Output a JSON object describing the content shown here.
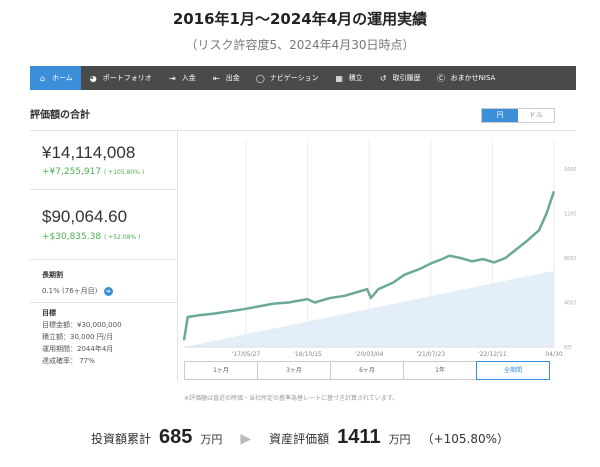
{
  "header": {
    "title": "2016年1月〜2024年4月の運用実績",
    "subtitle": "（リスク許容度5、2024年4月30日時点）"
  },
  "nav": {
    "items": [
      {
        "label": "ホーム",
        "icon": "home-icon",
        "active": true
      },
      {
        "label": "ポートフォリオ",
        "icon": "pie-chart-icon"
      },
      {
        "label": "入金",
        "icon": "deposit-icon"
      },
      {
        "label": "出金",
        "icon": "withdraw-icon"
      },
      {
        "label": "ナビゲーション",
        "icon": "compass-icon"
      },
      {
        "label": "積立",
        "icon": "savings-icon"
      },
      {
        "label": "取引履歴",
        "icon": "history-icon"
      },
      {
        "label": "おまかせNISA",
        "icon": "nisa-icon"
      }
    ]
  },
  "section": {
    "title": "評価額の合計",
    "currency_options": [
      "円",
      "ドル"
    ],
    "currency_selected": "円"
  },
  "summary_panel": {
    "jpy_value": "¥14,114,008",
    "jpy_change": "+¥7,255,917",
    "jpy_change_pct": "( +105.80% )",
    "usd_value": "$90,064.60",
    "usd_change": "+$30,835.38",
    "usd_change_pct": "( +52.08% )",
    "long_term_label": "長期割",
    "long_term_value": "0.1% (76ヶ月目)",
    "goal_label": "目標",
    "goal_amount": "目標金額：¥30,000,000",
    "goal_monthly": "積立額：30,000 円/月",
    "goal_period": "運用期間：2044年4月",
    "goal_rate": "達成確率： 77%"
  },
  "ranges": {
    "options": [
      "1ヶ月",
      "3ヶ月",
      "6ヶ月",
      "1年",
      "全期間"
    ],
    "selected": "全期間"
  },
  "note": "※評価額は直近の時価・当社所定の基準為替レートに基づき計算されています。",
  "bottom": {
    "invest_label": "投資額累計",
    "invest_num": "685",
    "invest_unit": "万円",
    "value_label": "資産評価額",
    "value_num": "1411",
    "value_unit": "万円",
    "value_pct": "（+105.80%）"
  },
  "colors": {
    "accent": "#3a8fd8",
    "nav_bg": "#4a4a4a",
    "positive": "#4caf50",
    "line": "#6aa89a",
    "area": "#e4eef8"
  },
  "chart_data": {
    "type": "area",
    "y_unit": "万円",
    "ylim": [
      0,
      1600
    ],
    "y_ticks": [
      "0万",
      "400万",
      "800万",
      "1200万",
      "1600万"
    ],
    "x_ticks": [
      "'17/05/27",
      "'18/10/15",
      "'20/03/04",
      "'21/07/23",
      "'22/12/11",
      "04/30"
    ],
    "series": [
      {
        "x": [
          "2016-01",
          "2016-02",
          "2016-05",
          "2016-09",
          "2017-01",
          "2017-05",
          "2017-09",
          "2018-01",
          "2018-05",
          "2018-10",
          "2018-12",
          "2019-04",
          "2019-08",
          "2019-12",
          "2020-02",
          "2020-03",
          "2020-05",
          "2020-09",
          "2020-12",
          "2021-04",
          "2021-07",
          "2021-10",
          "2021-12",
          "2022-03",
          "2022-06",
          "2022-09",
          "2022-12",
          "2023-03",
          "2023-06",
          "2023-09",
          "2023-12",
          "2024-02",
          "2024-04"
        ],
        "values": [
          60,
          270,
          285,
          300,
          320,
          340,
          365,
          390,
          400,
          430,
          400,
          440,
          460,
          500,
          520,
          440,
          520,
          580,
          650,
          700,
          750,
          790,
          820,
          800,
          770,
          790,
          760,
          800,
          880,
          960,
          1050,
          1200,
          1400
        ]
      },
      {
        "x": [
          "2016-01",
          "2024-04"
        ],
        "values": [
          0,
          685
        ]
      }
    ]
  }
}
